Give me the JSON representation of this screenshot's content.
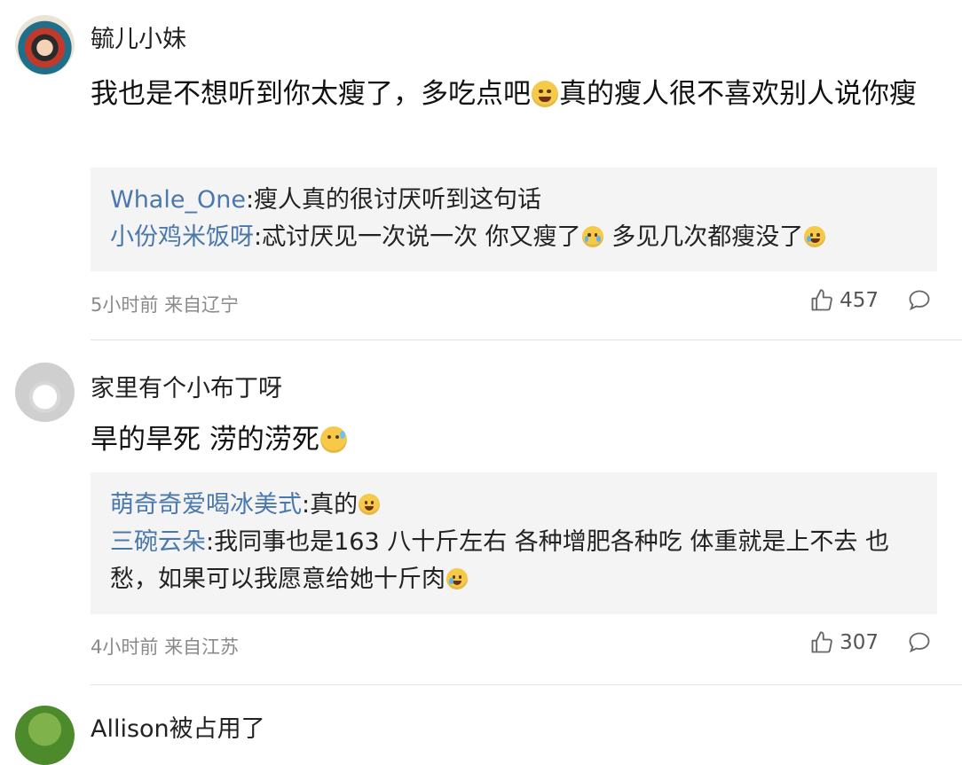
{
  "comments": [
    {
      "username": "毓儿小妹",
      "body_part1": "我也是不想听到你太瘦了，多吃点吧",
      "body_part2": "真的瘦人很不喜欢别人说你瘦",
      "body_emoji": "grinning-face-emoji",
      "replies": [
        {
          "name": "Whale_One",
          "text": ":瘦人真的很讨厌听到这句话"
        },
        {
          "name": "小份鸡米饭呀",
          "text": ":忒讨厌见一次说一次 你又瘦了",
          "text2": " 多见几次都瘦没了"
        }
      ],
      "time": "5小时前",
      "location": "来自辽宁",
      "likes": "457"
    },
    {
      "username": "家里有个小布丁呀",
      "body_part1": "旱的旱死 涝的涝死",
      "body_emoji": "sweat-face-emoji",
      "replies": [
        {
          "name": "萌奇奇爱喝冰美式",
          "text": ":真的"
        },
        {
          "name": "三碗云朵",
          "text": ":我同事也是163 八十斤左右 各种增肥各种吃 体重就是上不去 也愁，如果可以我愿意给她十斤肉"
        }
      ],
      "time": "4小时前",
      "location": "来自江苏",
      "likes": "307"
    },
    {
      "username": "Allison被占用了"
    }
  ],
  "colors": {
    "link": "#4a78ad",
    "meta": "#8a8a8a",
    "reply_bg": "#f4f4f4"
  }
}
